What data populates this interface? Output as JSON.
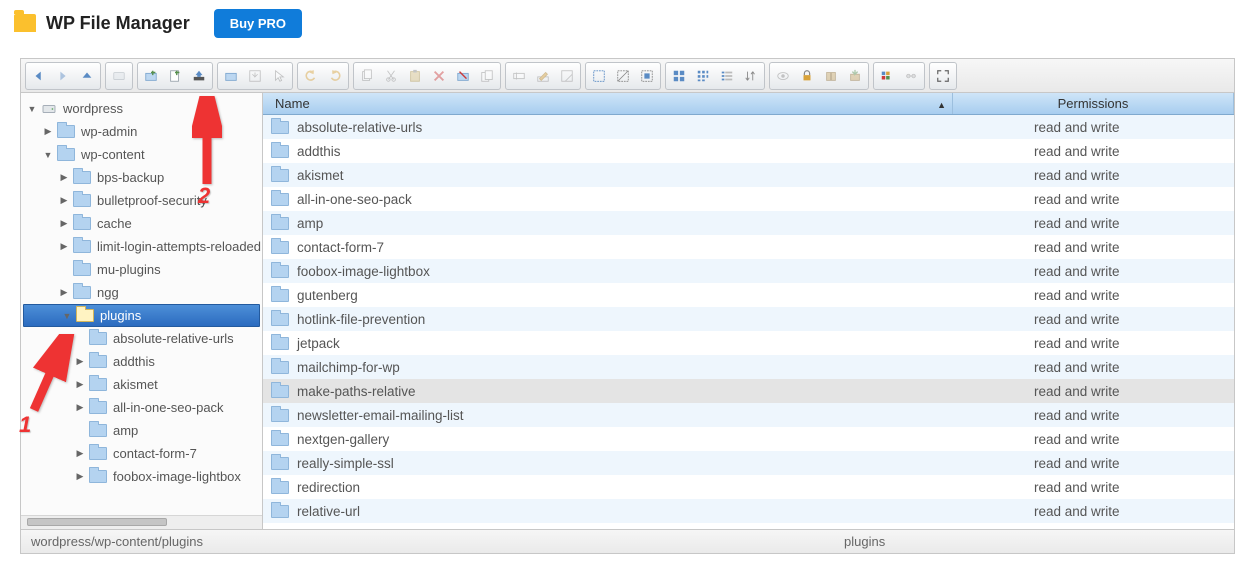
{
  "header": {
    "title": "WP File Manager",
    "buy_label": "Buy PRO"
  },
  "toolbar": {
    "groups": [
      [
        {
          "name": "back-icon",
          "svg": "arrow-left",
          "enabled": true
        },
        {
          "name": "forward-icon",
          "svg": "arrow-right",
          "enabled": false
        },
        {
          "name": "up-icon",
          "svg": "arrow-up",
          "enabled": true
        }
      ],
      [
        {
          "name": "netmount-icon",
          "svg": "drive",
          "enabled": false
        }
      ],
      [
        {
          "name": "new-folder-icon",
          "svg": "new-folder",
          "enabled": true
        },
        {
          "name": "new-file-icon",
          "svg": "new-file",
          "enabled": true
        },
        {
          "name": "upload-icon",
          "svg": "upload",
          "enabled": true
        }
      ],
      [
        {
          "name": "open-icon",
          "svg": "open",
          "enabled": true
        },
        {
          "name": "download-icon",
          "svg": "download",
          "enabled": false
        },
        {
          "name": "getfile-icon",
          "svg": "pointer",
          "enabled": false
        }
      ],
      [
        {
          "name": "undo-icon",
          "svg": "undo",
          "enabled": false
        },
        {
          "name": "redo-icon",
          "svg": "redo",
          "enabled": false
        }
      ],
      [
        {
          "name": "copy-icon",
          "svg": "copy",
          "enabled": false
        },
        {
          "name": "cut-icon",
          "svg": "cut",
          "enabled": false
        },
        {
          "name": "paste-icon",
          "svg": "paste",
          "enabled": false
        },
        {
          "name": "delete-icon",
          "svg": "delete",
          "enabled": false
        },
        {
          "name": "empty-icon",
          "svg": "empty",
          "enabled": true
        },
        {
          "name": "duplicate-icon",
          "svg": "duplicate",
          "enabled": false
        }
      ],
      [
        {
          "name": "rename-icon",
          "svg": "rename",
          "enabled": false
        },
        {
          "name": "edit-icon",
          "svg": "edit",
          "enabled": false
        },
        {
          "name": "resize-icon",
          "svg": "resize",
          "enabled": false
        }
      ],
      [
        {
          "name": "select-all-icon",
          "svg": "select-all",
          "enabled": true
        },
        {
          "name": "select-none-icon",
          "svg": "select-none",
          "enabled": true
        },
        {
          "name": "select-invert-icon",
          "svg": "select-invert",
          "enabled": true
        }
      ],
      [
        {
          "name": "view-icons-icon",
          "svg": "grid-lg",
          "enabled": true
        },
        {
          "name": "view-small-icon",
          "svg": "grid-sm",
          "enabled": true
        },
        {
          "name": "view-list-icon",
          "svg": "list",
          "enabled": true
        },
        {
          "name": "sort-icon",
          "svg": "sort",
          "enabled": true
        }
      ],
      [
        {
          "name": "preview-icon",
          "svg": "eye",
          "enabled": false
        },
        {
          "name": "lock-icon",
          "svg": "lock",
          "enabled": true
        },
        {
          "name": "archive-icon",
          "svg": "archive",
          "enabled": false
        },
        {
          "name": "extract-icon",
          "svg": "extract",
          "enabled": false
        }
      ],
      [
        {
          "name": "info-icon",
          "svg": "info",
          "enabled": true
        },
        {
          "name": "chmod-icon",
          "svg": "chmod",
          "enabled": false
        }
      ],
      [
        {
          "name": "fullscreen-icon",
          "svg": "fullscreen",
          "enabled": true
        }
      ]
    ]
  },
  "columns": {
    "name": "Name",
    "permissions": "Permissions"
  },
  "tree": [
    {
      "depth": 0,
      "twist": "down",
      "icon": "drive",
      "label": "wordpress",
      "selected": false
    },
    {
      "depth": 1,
      "twist": "right",
      "icon": "folder",
      "label": "wp-admin",
      "selected": false
    },
    {
      "depth": 1,
      "twist": "down",
      "icon": "folder",
      "label": "wp-content",
      "selected": false
    },
    {
      "depth": 2,
      "twist": "right",
      "icon": "folder",
      "label": "bps-backup",
      "selected": false
    },
    {
      "depth": 2,
      "twist": "right",
      "icon": "folder",
      "label": "bulletproof-security",
      "selected": false
    },
    {
      "depth": 2,
      "twist": "right",
      "icon": "folder",
      "label": "cache",
      "selected": false
    },
    {
      "depth": 2,
      "twist": "right",
      "icon": "folder",
      "label": "limit-login-attempts-reloaded",
      "selected": false
    },
    {
      "depth": 2,
      "twist": "blank",
      "icon": "folder",
      "label": "mu-plugins",
      "selected": false
    },
    {
      "depth": 2,
      "twist": "right",
      "icon": "folder",
      "label": "ngg",
      "selected": false
    },
    {
      "depth": 2,
      "twist": "down",
      "icon": "folder",
      "label": "plugins",
      "selected": true
    },
    {
      "depth": 3,
      "twist": "blank",
      "icon": "folder",
      "label": "absolute-relative-urls",
      "selected": false
    },
    {
      "depth": 3,
      "twist": "right",
      "icon": "folder",
      "label": "addthis",
      "selected": false
    },
    {
      "depth": 3,
      "twist": "right",
      "icon": "folder",
      "label": "akismet",
      "selected": false
    },
    {
      "depth": 3,
      "twist": "right",
      "icon": "folder",
      "label": "all-in-one-seo-pack",
      "selected": false
    },
    {
      "depth": 3,
      "twist": "blank",
      "icon": "folder",
      "label": "amp",
      "selected": false
    },
    {
      "depth": 3,
      "twist": "right",
      "icon": "folder",
      "label": "contact-form-7",
      "selected": false
    },
    {
      "depth": 3,
      "twist": "right",
      "icon": "folder",
      "label": "foobox-image-lightbox",
      "selected": false
    }
  ],
  "files": [
    {
      "name": "absolute-relative-urls",
      "perm": "read and write"
    },
    {
      "name": "addthis",
      "perm": "read and write"
    },
    {
      "name": "akismet",
      "perm": "read and write"
    },
    {
      "name": "all-in-one-seo-pack",
      "perm": "read and write"
    },
    {
      "name": "amp",
      "perm": "read and write"
    },
    {
      "name": "contact-form-7",
      "perm": "read and write"
    },
    {
      "name": "foobox-image-lightbox",
      "perm": "read and write"
    },
    {
      "name": "gutenberg",
      "perm": "read and write"
    },
    {
      "name": "hotlink-file-prevention",
      "perm": "read and write"
    },
    {
      "name": "jetpack",
      "perm": "read and write"
    },
    {
      "name": "mailchimp-for-wp",
      "perm": "read and write"
    },
    {
      "name": "make-paths-relative",
      "perm": "read and write",
      "highlight": true
    },
    {
      "name": "newsletter-email-mailing-list",
      "perm": "read and write"
    },
    {
      "name": "nextgen-gallery",
      "perm": "read and write"
    },
    {
      "name": "really-simple-ssl",
      "perm": "read and write"
    },
    {
      "name": "redirection",
      "perm": "read and write"
    },
    {
      "name": "relative-url",
      "perm": "read and write"
    }
  ],
  "status": {
    "path": "wordpress/wp-content/plugins",
    "selection": "plugins"
  },
  "annotations": {
    "n1": "1",
    "n2": "2"
  }
}
